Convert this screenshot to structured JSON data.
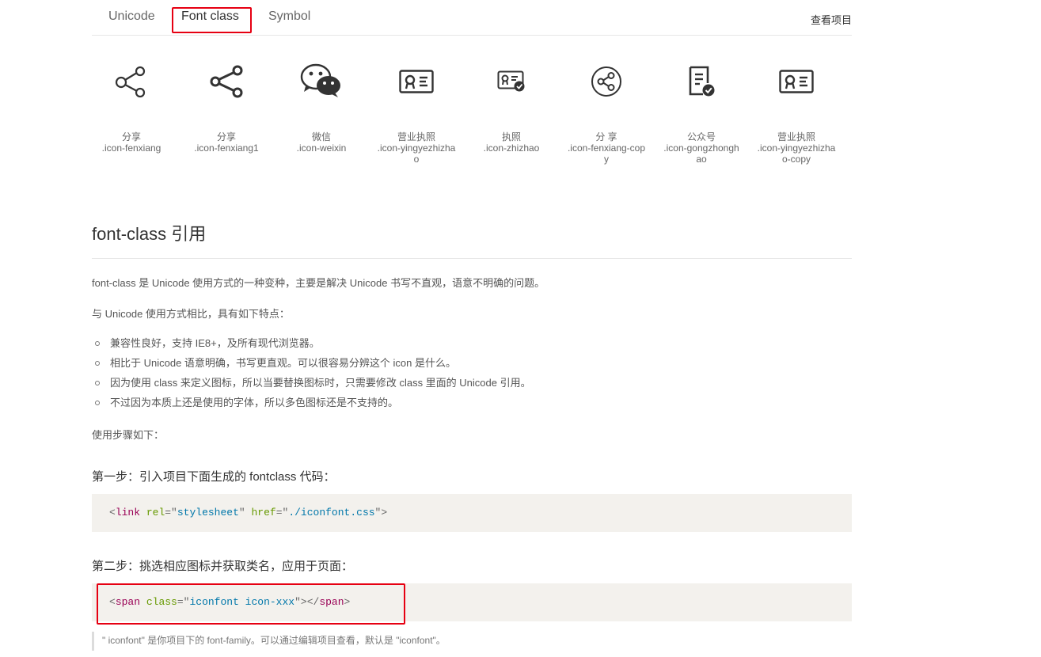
{
  "tabs": {
    "unicode": "Unicode",
    "font_class": "Font class",
    "symbol": "Symbol",
    "view_project": "查看项目"
  },
  "icons": [
    {
      "name": "分享",
      "code": ".icon-fenxiang",
      "icon": "share-outline-icon"
    },
    {
      "name": "分享",
      "code": ".icon-fenxiang1",
      "icon": "share-icon"
    },
    {
      "name": "微信",
      "code": ".icon-weixin",
      "icon": "wechat-icon"
    },
    {
      "name": "营业执照",
      "code": ".icon-yingyezhizhao",
      "icon": "business-license-icon"
    },
    {
      "name": "执照",
      "code": ".icon-zhizhao",
      "icon": "license-check-icon"
    },
    {
      "name": "分 享",
      "code": ".icon-fenxiang-copy",
      "icon": "share-circle-icon"
    },
    {
      "name": "公众号",
      "code": ".icon-gongzhonghao",
      "icon": "official-account-icon"
    },
    {
      "name": "营业执照",
      "code": ".icon-yingyezhizhao-copy",
      "icon": "business-license-icon"
    }
  ],
  "section": {
    "title": "font-class 引用",
    "intro": "font-class 是 Unicode 使用方式的一种变种，主要是解决 Unicode 书写不直观，语意不明确的问题。",
    "compare": "与 Unicode 使用方式相比，具有如下特点：",
    "features": [
      "兼容性良好，支持 IE8+，及所有现代浏览器。",
      "相比于 Unicode 语意明确，书写更直观。可以很容易分辨这个 icon 是什么。",
      "因为使用 class 来定义图标，所以当要替换图标时，只需要修改 class 里面的 Unicode 引用。",
      "不过因为本质上还是使用的字体，所以多色图标还是不支持的。"
    ],
    "steps_label": "使用步骤如下：",
    "step1_title": "第一步：引入项目下面生成的 fontclass 代码：",
    "step1_code": {
      "tag": "link",
      "attr1": "rel",
      "val1": "stylesheet",
      "attr2": "href",
      "val2": "./iconfont.css"
    },
    "step2_title": "第二步：挑选相应图标并获取类名，应用于页面：",
    "step2_code": {
      "tag": "span",
      "attr": "class",
      "val": "iconfont icon-xxx"
    },
    "note": "\" iconfont\" 是你项目下的 font-family。可以通过编辑项目查看，默认是 \"iconfont\"。"
  },
  "colors": {
    "highlight": "#e60012",
    "code_bg": "#f3f1ed",
    "icon": "#333333"
  }
}
